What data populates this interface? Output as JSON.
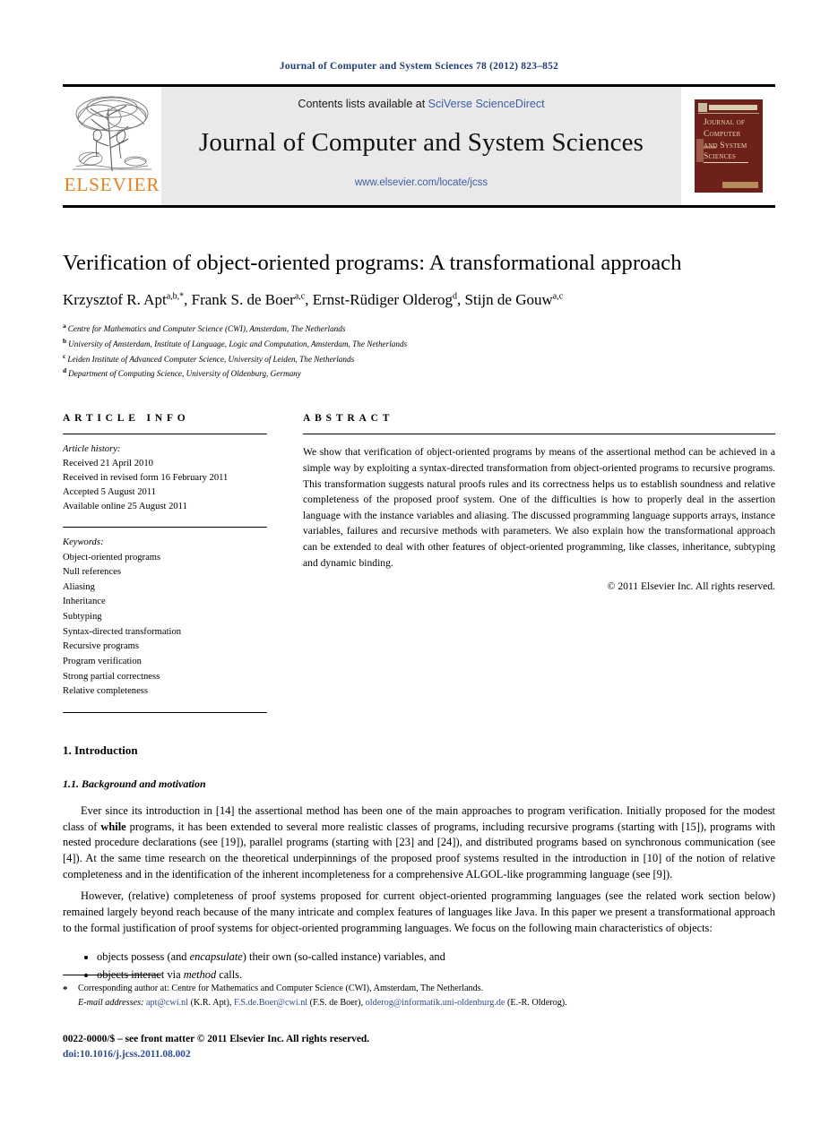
{
  "running_head": "Journal of Computer and System Sciences 78 (2012) 823–852",
  "masthead": {
    "publisher_name": "ELSEVIER",
    "contents_prefix": "Contents lists available at ",
    "sciencedirect_link": "SciVerse ScienceDirect",
    "journal_name": "Journal of Computer and System Sciences",
    "journal_url": "www.elsevier.com/locate/jcss",
    "cover_line1": "Journal of",
    "cover_line2": "Computer",
    "cover_line3": "and System",
    "cover_line4": "Sciences"
  },
  "article": {
    "title": "Verification of object-oriented programs: A transformational approach",
    "authors": [
      {
        "name": "Krzysztof R. Apt",
        "marks": "a,b,*",
        "sep": ", "
      },
      {
        "name": "Frank S. de Boer",
        "marks": "a,c",
        "sep": ", "
      },
      {
        "name": "Ernst-Rüdiger Olderog",
        "marks": "d",
        "sep": ", "
      },
      {
        "name": "Stijn de Gouw",
        "marks": "a,c",
        "sep": ""
      }
    ],
    "affiliations": [
      {
        "mark": "a",
        "text": "Centre for Mathematics and Computer Science (CWI), Amsterdam, The Netherlands"
      },
      {
        "mark": "b",
        "text": "University of Amsterdam, Institute of Language, Logic and Computation, Amsterdam, The Netherlands"
      },
      {
        "mark": "c",
        "text": "Leiden Institute of Advanced Computer Science, University of Leiden, The Netherlands"
      },
      {
        "mark": "d",
        "text": "Department of Computing Science, University of Oldenburg, Germany"
      }
    ]
  },
  "article_info": {
    "heading": "ARTICLE INFO",
    "history_label": "Article history:",
    "history": [
      "Received 21 April 2010",
      "Received in revised form 16 February 2011",
      "Accepted 5 August 2011",
      "Available online 25 August 2011"
    ],
    "keywords_label": "Keywords:",
    "keywords": [
      "Object-oriented programs",
      "Null references",
      "Aliasing",
      "Inheritance",
      "Subtyping",
      "Syntax-directed transformation",
      "Recursive programs",
      "Program verification",
      "Strong partial correctness",
      "Relative completeness"
    ]
  },
  "abstract": {
    "heading": "ABSTRACT",
    "text": "We show that verification of object-oriented programs by means of the assertional method can be achieved in a simple way by exploiting a syntax-directed transformation from object-oriented programs to recursive programs. This transformation suggests natural proofs rules and its correctness helps us to establish soundness and relative completeness of the proposed proof system. One of the difficulties is how to properly deal in the assertion language with the instance variables and aliasing. The discussed programming language supports arrays, instance variables, failures and recursive methods with parameters. We also explain how the transformational approach can be extended to deal with other features of object-oriented programming, like classes, inheritance, subtyping and dynamic binding.",
    "copyright": "© 2011 Elsevier Inc. All rights reserved."
  },
  "body": {
    "section_number_title": "1. Introduction",
    "subsection_title": "1.1. Background and motivation",
    "para1_a": "Ever since its introduction in [14] the assertional method has been one of the main approaches to program verification. Initially proposed for the modest class of ",
    "para1_while": "while",
    "para1_b": " programs, it has been extended to several more realistic classes of programs, including recursive programs (starting with [15]), programs with nested procedure declarations (see [19]), parallel programs (starting with [23] and [24]), and distributed programs based on synchronous communication (see [4]). At the same time research on the theoretical underpinnings of the proposed proof systems resulted in the introduction in [10] of the notion of relative completeness and in the identification of the inherent incompleteness for a comprehensive ALGOL-like programming language (see [9]).",
    "para2": "However, (relative) completeness of proof systems proposed for current object-oriented programming languages (see the related work section below) remained largely beyond reach because of the many intricate and complex features of languages like Java. In this paper we present a transformational approach to the formal justification of proof systems for object-oriented programming languages. We focus on the following main characteristics of objects:",
    "bullet1_a": "objects possess (and ",
    "bullet1_em": "encapsulate",
    "bullet1_b": ") their own (so-called instance) variables, and",
    "bullet2_a": "objects interact via ",
    "bullet2_em": "method",
    "bullet2_b": " calls."
  },
  "footnotes": {
    "corresponding": "Corresponding author at: Centre for Mathematics and Computer Science (CWI), Amsterdam, The Netherlands.",
    "email_label": "E-mail addresses:",
    "emails": [
      {
        "address": "apt@cwi.nl",
        "who": " (K.R. Apt), "
      },
      {
        "address": "F.S.de.Boer@cwi.nl",
        "who": " (F.S. de Boer), "
      },
      {
        "address": "olderog@informatik.uni-oldenburg.de",
        "who": " (E.-R. Olderog)."
      }
    ]
  },
  "colophon": {
    "issn_line_issn": "0022-0000/$ – see front matter",
    "issn_line_rest": "  © 2011 Elsevier Inc. All rights reserved.",
    "doi": "doi:10.1016/j.jcss.2011.08.002"
  }
}
